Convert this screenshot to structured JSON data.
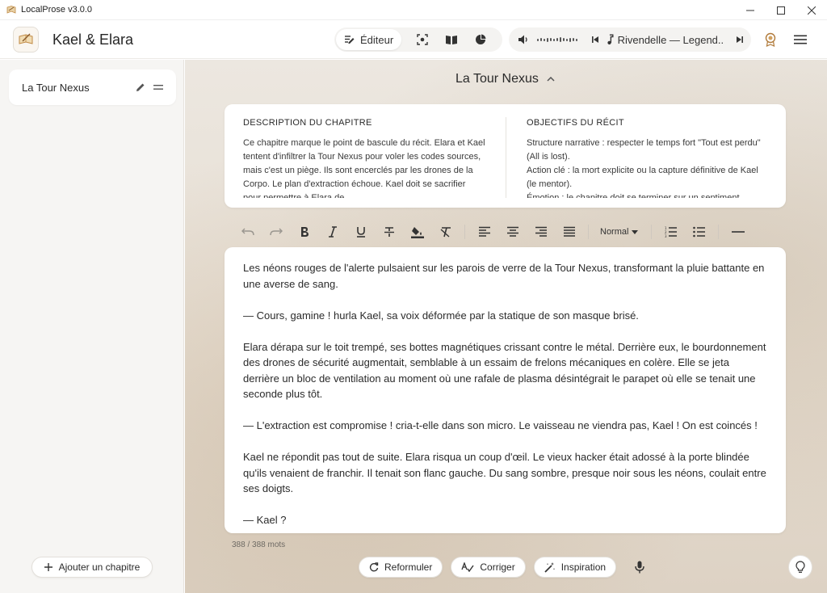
{
  "window": {
    "title": "LocalProse v3.0.0"
  },
  "header": {
    "project_title": "Kael & Elara",
    "mode_label": "Éditeur",
    "player": {
      "track": "Rivendelle — Legend..."
    }
  },
  "sidebar": {
    "chapters": [
      {
        "label": "La Tour Nexus"
      }
    ],
    "add_chapter_label": "Ajouter un chapitre"
  },
  "main": {
    "chapter_title": "La Tour Nexus",
    "description": {
      "heading": "DESCRIPTION DU CHAPITRE",
      "text": "Ce chapitre marque le point de bascule du récit. Elara et Kael tentent d'infiltrer la Tour Nexus pour voler les codes sources, mais c'est un piège. Ils sont encerclés par les drones de la Corpo. Le plan d'extraction échoue. Kael doit se sacrifier pour permettre à Elara de"
    },
    "objectives": {
      "heading": "OBJECTIFS DU RÉCIT",
      "lines": [
        "Structure narrative : respecter le temps fort \"Tout est perdu\" (All is lost).",
        "Action clé : la mort explicite ou la capture définitive de Kael (le mentor).",
        "Émotion : le chapitre doit se terminer sur un sentiment"
      ]
    },
    "toolbar": {
      "style_select": "Normal"
    },
    "editor_paragraphs": [
      "Les néons rouges de l'alerte pulsaient sur les parois de verre de la Tour Nexus, transformant la pluie battante en une averse de sang.",
      "— Cours, gamine ! hurla Kael, sa voix déformée par la statique de son masque brisé.",
      "Elara dérapa sur le toit trempé, ses bottes magnétiques crissant contre le métal. Derrière eux, le bourdonnement des drones de sécurité augmentait, semblable à un essaim de frelons mécaniques en colère. Elle se jeta derrière un bloc de ventilation au moment où une rafale de plasma désintégrait le parapet où elle se tenait une seconde plus tôt.",
      "— L'extraction est compromise ! cria-t-elle dans son micro. Le vaisseau ne viendra pas, Kael ! On est coincés !",
      "Kael ne répondit pas tout de suite. Elara risqua un coup d'œil. Le vieux hacker était adossé à la porte blindée qu'ils venaient de franchir. Il tenait son flanc gauche. Du sang sombre, presque noir sous les néons, coulait entre ses doigts.",
      "— Kael ?"
    ],
    "word_count": "388 / 388 mots",
    "actions": {
      "rephrase": "Reformuler",
      "correct": "Corriger",
      "inspiration": "Inspiration"
    }
  },
  "colors": {
    "accent": "#c8a26a",
    "sidebar_bg": "#f6f5f3",
    "main_bg": "#e6ddd1"
  }
}
